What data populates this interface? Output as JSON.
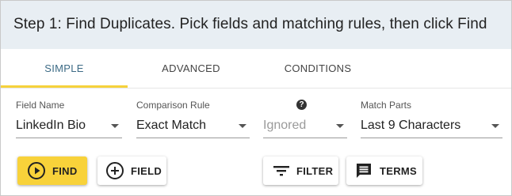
{
  "banner": {
    "text": "Step 1: Find Duplicates. Pick fields and matching rules, then click Find"
  },
  "tabs": [
    {
      "label": "SIMPLE",
      "active": true
    },
    {
      "label": "ADVANCED",
      "active": false
    },
    {
      "label": "CONDITIONS",
      "active": false
    }
  ],
  "fields": {
    "field_name": {
      "label": "Field Name",
      "value": "LinkedIn Bio"
    },
    "comparison_rule": {
      "label": "Comparison Rule",
      "value": "Exact Match"
    },
    "third": {
      "value": "Ignored",
      "help_icon": "?"
    },
    "match_parts": {
      "label": "Match Parts",
      "value": "Last 9 Characters"
    }
  },
  "buttons": {
    "find": "FIND",
    "field": "FIELD",
    "filter": "FILTER",
    "terms": "TERMS"
  },
  "colors": {
    "accent": "#f8d23a",
    "banner_bg": "#e8eef3",
    "active_tab": "#3d6b86"
  }
}
